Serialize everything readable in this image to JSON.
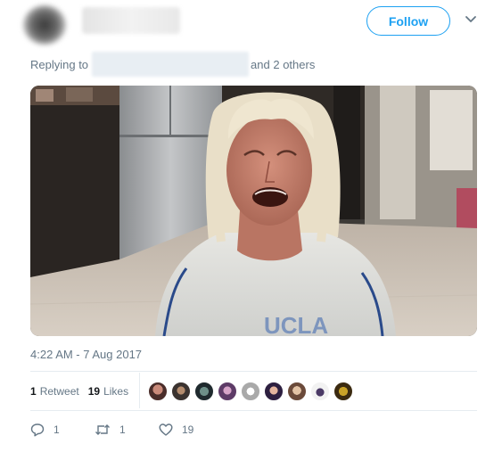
{
  "header": {
    "follow_label": "Follow",
    "caret_icon": "chevron-down-icon"
  },
  "reply": {
    "prefix": "Replying to",
    "suffix": "and 2 others"
  },
  "media": {
    "description_icon": "gif-image"
  },
  "tweet": {
    "timestamp": "4:22 AM - 7 Aug 2017"
  },
  "stats": {
    "retweets_count": "1",
    "retweets_label": "Retweet",
    "likes_count": "19",
    "likes_label": "Likes"
  },
  "actions": {
    "reply_count": "1",
    "retweet_count": "1",
    "like_count": "19"
  },
  "colors": {
    "accent": "#1da1f2",
    "muted": "#657786",
    "divider": "#e6ecf0"
  }
}
